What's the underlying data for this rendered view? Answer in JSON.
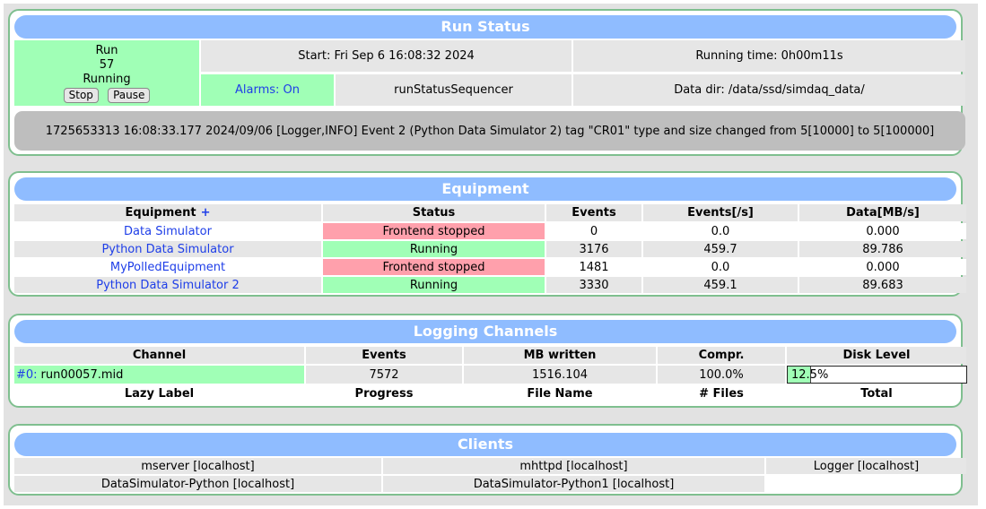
{
  "run_status": {
    "header": "Run Status",
    "run_label": "Run",
    "run_number": "57",
    "state": "Running",
    "stop_label": "Stop",
    "pause_label": "Pause",
    "start": "Start: Fri Sep 6 16:08:32 2024",
    "running_time": "Running time: 0h00m11s",
    "alarms": "Alarms: On",
    "sequencer": "runStatusSequencer",
    "data_dir": "Data dir: /data/ssd/simdaq_data/",
    "message": "1725653313 16:08:33.177 2024/09/06 [Logger,INFO] Event 2 (Python Data Simulator 2) tag \"CR01\" type and size changed from 5[10000] to 5[100000]"
  },
  "equipment": {
    "header": "Equipment",
    "columns": [
      "Equipment",
      "Status",
      "Events",
      "Events[/s]",
      "Data[MB/s]"
    ],
    "add_symbol": "+",
    "rows": [
      {
        "name": "Data Simulator",
        "status": "Frontend stopped",
        "state": "stopped",
        "events": "0",
        "rate": "0.0",
        "data": "0.000"
      },
      {
        "name": "Python Data Simulator",
        "status": "Running",
        "state": "running",
        "events": "3176",
        "rate": "459.7",
        "data": "89.786"
      },
      {
        "name": "MyPolledEquipment",
        "status": "Frontend stopped",
        "state": "stopped",
        "events": "1481",
        "rate": "0.0",
        "data": "0.000"
      },
      {
        "name": "Python Data Simulator 2",
        "status": "Running",
        "state": "running",
        "events": "3330",
        "rate": "459.1",
        "data": "89.683"
      }
    ]
  },
  "logging": {
    "header": "Logging Channels",
    "columns": [
      "Channel",
      "Events",
      "MB written",
      "Compr.",
      "Disk Level"
    ],
    "channel_id": "#0:",
    "channel_file": "run00057.mid",
    "events": "7572",
    "mb_written": "1516.104",
    "compression": "100.0%",
    "disk_level_text": "12.5%",
    "disk_level_fraction": 0.125,
    "lazy_columns": [
      "Lazy Label",
      "Progress",
      "File Name",
      "# Files",
      "Total"
    ]
  },
  "clients": {
    "header": "Clients",
    "items": [
      "mserver [localhost]",
      "mhttpd [localhost]",
      "Logger [localhost]",
      "DataSimulator-Python [localhost]",
      "DataSimulator-Python1 [localhost]"
    ]
  },
  "colors": {
    "header_blue": "#8fbcff",
    "running_green": "#a0ffb6",
    "stopped_red": "#ffa0ac",
    "link_blue": "#1e3ee8",
    "panel_border": "#7fbf8f"
  }
}
